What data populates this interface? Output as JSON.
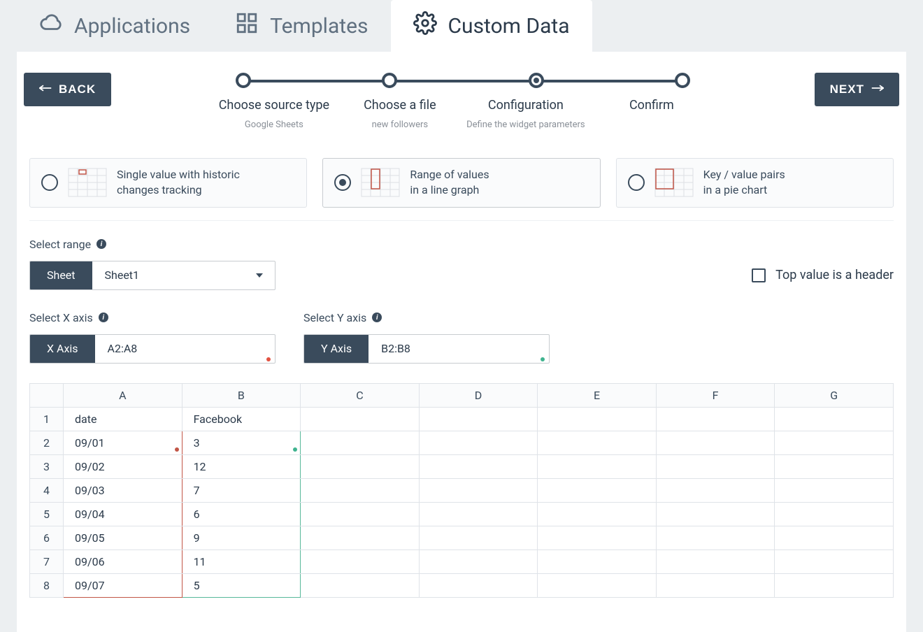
{
  "tabs": {
    "applications": "Applications",
    "templates": "Templates",
    "customData": "Custom Data"
  },
  "buttons": {
    "back": "BACK",
    "next": "NEXT"
  },
  "steps": [
    {
      "title": "Choose source type",
      "sub": "Google Sheets"
    },
    {
      "title": "Choose a file",
      "sub": "new followers"
    },
    {
      "title": "Configuration",
      "sub": "Define the widget parameters"
    },
    {
      "title": "Confirm",
      "sub": ""
    }
  ],
  "activeStepIndex": 2,
  "modes": {
    "single": {
      "line1": "Single value with historic",
      "line2": "changes tracking"
    },
    "range": {
      "line1": "Range of values",
      "line2": "in a line graph"
    },
    "kv": {
      "line1": "Key / value pairs",
      "line2": "in a pie chart"
    }
  },
  "selectedMode": "range",
  "labels": {
    "selectRange": "Select range",
    "selectX": "Select X axis",
    "selectY": "Select Y axis",
    "topHeader": "Top value is a header"
  },
  "sheetSelector": {
    "label": "Sheet",
    "value": "Sheet1"
  },
  "xAxis": {
    "label": "X Axis",
    "value": "A2:A8"
  },
  "yAxis": {
    "label": "Y Axis",
    "value": "B2:B8"
  },
  "topValueIsHeader": false,
  "sheet": {
    "columns": [
      "A",
      "B",
      "C",
      "D",
      "E",
      "F",
      "G"
    ],
    "rows": [
      {
        "n": 1,
        "cells": [
          "date",
          "Facebook",
          "",
          "",
          "",
          "",
          ""
        ]
      },
      {
        "n": 2,
        "cells": [
          "09/01",
          "3",
          "",
          "",
          "",
          "",
          ""
        ]
      },
      {
        "n": 3,
        "cells": [
          "09/02",
          "12",
          "",
          "",
          "",
          "",
          ""
        ]
      },
      {
        "n": 4,
        "cells": [
          "09/03",
          "7",
          "",
          "",
          "",
          "",
          ""
        ]
      },
      {
        "n": 5,
        "cells": [
          "09/04",
          "6",
          "",
          "",
          "",
          "",
          ""
        ]
      },
      {
        "n": 6,
        "cells": [
          "09/05",
          "9",
          "",
          "",
          "",
          "",
          ""
        ]
      },
      {
        "n": 7,
        "cells": [
          "09/06",
          "11",
          "",
          "",
          "",
          "",
          ""
        ]
      },
      {
        "n": 8,
        "cells": [
          "09/07",
          "5",
          "",
          "",
          "",
          "",
          ""
        ]
      }
    ],
    "xRange": {
      "col": 0,
      "rowStart": 2,
      "rowEnd": 8
    },
    "yRange": {
      "col": 1,
      "rowStart": 2,
      "rowEnd": 8
    }
  },
  "colors": {
    "accent": "#3a4b5c",
    "red": "#c15546",
    "green": "#57b89a"
  }
}
